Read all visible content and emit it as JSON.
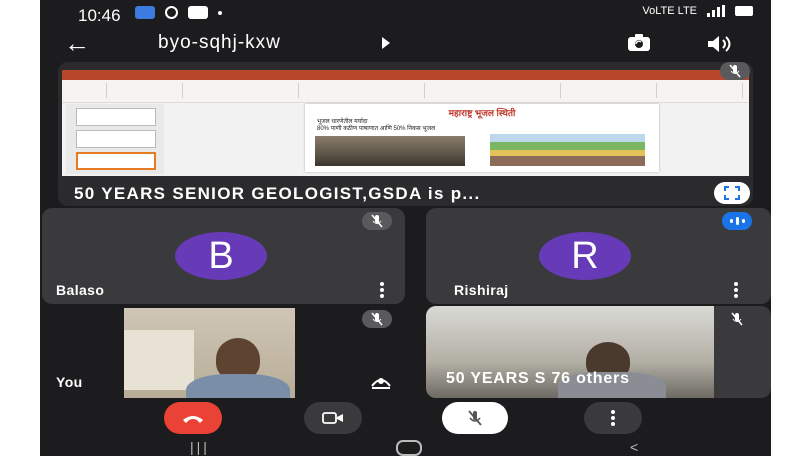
{
  "status_bar": {
    "time": "10:46",
    "network": "VoLTE LTE"
  },
  "meeting": {
    "code": "byo-sqhj-kxw"
  },
  "presentation": {
    "slide_title": "महाराष्ट्र भूजल स्थिती",
    "bullet_1": "भूजल धारणेतील मर्यादा",
    "bullet_2": "80% पाणी कठीण पाषाणात आणि 50% निकस भूजल",
    "presenter_text": "50 YEARS SENIOR GEOLOGIST,GSDA is p..."
  },
  "participants": [
    {
      "initial": "B",
      "name": "Balaso"
    },
    {
      "initial": "R",
      "name": "Rishiraj"
    }
  ],
  "self_tile": {
    "label": "You"
  },
  "others_tile": {
    "label": "50 YEARS S 76 others"
  },
  "colors": {
    "accent_purple": "#673ab7",
    "speaking_blue": "#1a73e8",
    "end_call_red": "#ea4335",
    "tile_bg": "#3a3a3c"
  },
  "icons": [
    "back-arrow-icon",
    "switch-camera-icon",
    "speaker-icon",
    "mic-off-icon",
    "fullscreen-icon",
    "more-vert-icon",
    "end-call-icon",
    "camera-icon",
    "more-options-icon"
  ]
}
